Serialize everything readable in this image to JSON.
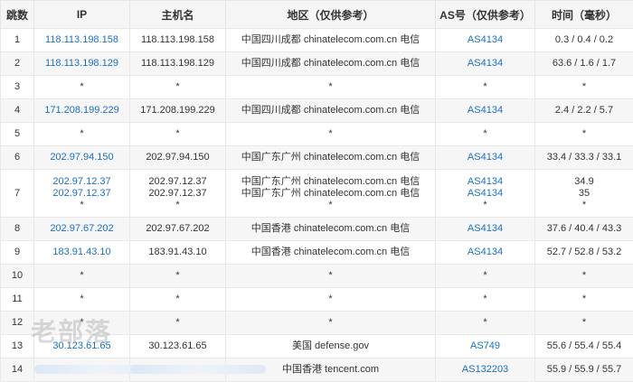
{
  "headers": [
    "跳数",
    "IP",
    "主机名",
    "地区（仅供参考）",
    "AS号（仅供参考）",
    "时间（毫秒）"
  ],
  "rows": [
    {
      "hop": "1",
      "ip": [
        "118.113.198.158"
      ],
      "host": [
        "118.113.198.158"
      ],
      "region": [
        "中国四川成都 chinatelecom.com.cn 电信"
      ],
      "asn": [
        "AS4134"
      ],
      "time": [
        "0.3 / 0.4 / 0.2"
      ]
    },
    {
      "hop": "2",
      "ip": [
        "118.113.198.129"
      ],
      "host": [
        "118.113.198.129"
      ],
      "region": [
        "中国四川成都 chinatelecom.com.cn 电信"
      ],
      "asn": [
        "AS4134"
      ],
      "time": [
        "63.6 / 1.6 / 1.7"
      ]
    },
    {
      "hop": "3",
      "ip": [
        "*"
      ],
      "host": [
        "*"
      ],
      "region": [
        "*"
      ],
      "asn": [
        "*"
      ],
      "time": [
        "*"
      ]
    },
    {
      "hop": "4",
      "ip": [
        "171.208.199.229"
      ],
      "host": [
        "171.208.199.229"
      ],
      "region": [
        "中国四川成都 chinatelecom.com.cn 电信"
      ],
      "asn": [
        "AS4134"
      ],
      "time": [
        "2.4 / 2.2 / 5.7"
      ]
    },
    {
      "hop": "5",
      "ip": [
        "*"
      ],
      "host": [
        "*"
      ],
      "region": [
        "*"
      ],
      "asn": [
        "*"
      ],
      "time": [
        "*"
      ]
    },
    {
      "hop": "6",
      "ip": [
        "202.97.94.150"
      ],
      "host": [
        "202.97.94.150"
      ],
      "region": [
        "中国广东广州 chinatelecom.com.cn 电信"
      ],
      "asn": [
        "AS4134"
      ],
      "time": [
        "33.4 / 33.3 / 33.1"
      ]
    },
    {
      "hop": "7",
      "ip": [
        "202.97.12.37",
        "202.97.12.37",
        "*"
      ],
      "host": [
        "202.97.12.37",
        "202.97.12.37",
        "*"
      ],
      "region": [
        "中国广东广州 chinatelecom.com.cn 电信",
        "中国广东广州 chinatelecom.com.cn 电信",
        "*"
      ],
      "asn": [
        "AS4134",
        "AS4134",
        "*"
      ],
      "time": [
        "34.9",
        "35",
        "*"
      ]
    },
    {
      "hop": "8",
      "ip": [
        "202.97.67.202"
      ],
      "host": [
        "202.97.67.202"
      ],
      "region": [
        "中国香港 chinatelecom.com.cn 电信"
      ],
      "asn": [
        "AS4134"
      ],
      "time": [
        "37.6 / 40.4 / 43.3"
      ]
    },
    {
      "hop": "9",
      "ip": [
        "183.91.43.10"
      ],
      "host": [
        "183.91.43.10"
      ],
      "region": [
        "中国香港 chinatelecom.com.cn 电信"
      ],
      "asn": [
        "AS4134"
      ],
      "time": [
        "52.7 / 52.8 / 53.2"
      ]
    },
    {
      "hop": "10",
      "ip": [
        "*"
      ],
      "host": [
        "*"
      ],
      "region": [
        "*"
      ],
      "asn": [
        "*"
      ],
      "time": [
        "*"
      ]
    },
    {
      "hop": "11",
      "ip": [
        "*"
      ],
      "host": [
        "*"
      ],
      "region": [
        "*"
      ],
      "asn": [
        "*"
      ],
      "time": [
        "*"
      ]
    },
    {
      "hop": "12",
      "ip": [
        "*"
      ],
      "host": [
        "*"
      ],
      "region": [
        "*"
      ],
      "asn": [
        "*"
      ],
      "time": [
        "*"
      ]
    },
    {
      "hop": "13",
      "ip": [
        "30.123.61.65"
      ],
      "host": [
        "30.123.61.65"
      ],
      "region": [
        "美国 defense.gov"
      ],
      "asn": [
        "AS749"
      ],
      "time": [
        "55.6 / 55.4 / 55.4"
      ]
    },
    {
      "hop": "14",
      "ip": [
        ""
      ],
      "host": [
        ""
      ],
      "region": [
        "中国香港 tencent.com"
      ],
      "asn": [
        "AS132203"
      ],
      "time": [
        "55.9 / 55.9 / 55.7"
      ]
    }
  ],
  "watermark": "老部落",
  "colors": {
    "link": "#1a6fc4",
    "header_bg": "#f5f5f5",
    "row_alt": "#f6f6f6",
    "border": "#e8e8e8"
  }
}
